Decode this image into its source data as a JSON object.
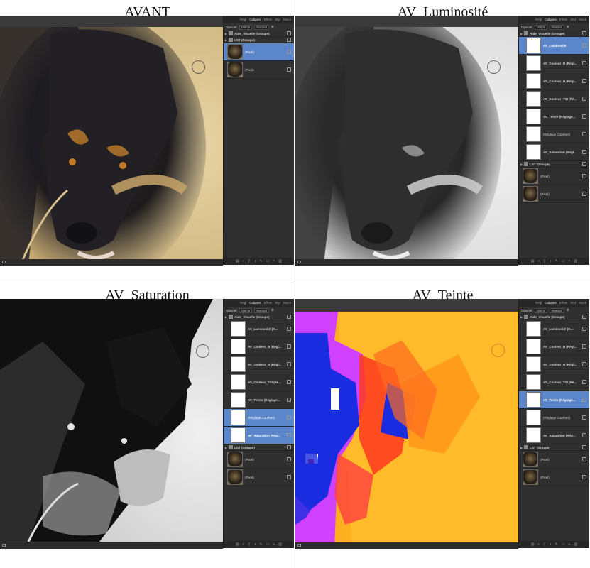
{
  "titles": {
    "q1": "AVANT",
    "q2": "AV_Luminosité",
    "q3": "AV_Saturation",
    "q4": "AV_Teinte"
  },
  "tabs": [
    "Régl",
    "Calques",
    "Effets",
    "Styl",
    "Stock"
  ],
  "active_tab": "Calques",
  "opacity_label": "Opacité",
  "opacity_value": "100 %",
  "blend_mode": "Normal",
  "layers_q1": [
    {
      "type": "grp",
      "name": "Aide_Visuelle (Groupe)"
    },
    {
      "type": "grp",
      "name": "LST (Groupe)"
    },
    {
      "type": "pix",
      "name": "(Pixel)",
      "selected": true
    },
    {
      "type": "pix",
      "name": "(Pixel)",
      "selected": false
    }
  ],
  "layers_q2": [
    {
      "type": "grp",
      "name": "Aide_Visuelle (Groupe)"
    },
    {
      "type": "adj",
      "name": "AV_Luminosité",
      "selected": true
    },
    {
      "type": "adj",
      "name": "AV_Couleur_B (Régl...",
      "selected": false
    },
    {
      "type": "adj",
      "name": "AV_Couleur_N (Régl...",
      "selected": false
    },
    {
      "type": "adj",
      "name": "AV_Couleur_TSI (Ré...",
      "selected": false
    },
    {
      "type": "adj",
      "name": "AV_Teinte (Réglage...",
      "selected": false
    },
    {
      "type": "adj",
      "name": "(Réglage Courbes)",
      "plain": true,
      "selected": false
    },
    {
      "type": "adj",
      "name": "AV_Saturation (Régl...",
      "selected": false
    },
    {
      "type": "grp",
      "name": "LST (Groupe)"
    },
    {
      "type": "pix",
      "name": "(Pixel)",
      "selected": false
    },
    {
      "type": "pix",
      "name": "(Pixel)",
      "selected": false
    }
  ],
  "layers_q3": [
    {
      "type": "grp",
      "name": "Aide_Visuelle (Groupe)"
    },
    {
      "type": "adj",
      "name": "AV_Luminosité (R...",
      "selected": false
    },
    {
      "type": "adj",
      "name": "AV_Couleur_B (Régl...",
      "selected": false
    },
    {
      "type": "adj",
      "name": "AV_Couleur_N (Régl...",
      "selected": false
    },
    {
      "type": "adj",
      "name": "AV_Couleur_TSI (Ré...",
      "selected": false
    },
    {
      "type": "adj",
      "name": "AV_Teinte (Réglage...",
      "selected": false
    },
    {
      "type": "adj",
      "name": "(Réglage Courbes)",
      "plain": true,
      "selected": true
    },
    {
      "type": "adj",
      "name": "AV_Saturation (Rég...",
      "selected": true
    },
    {
      "type": "grp",
      "name": "LST (Groupe)"
    },
    {
      "type": "pix",
      "name": "(Pixel)",
      "selected": false
    },
    {
      "type": "pix",
      "name": "(Pixel)",
      "selected": false
    }
  ],
  "layers_q4": [
    {
      "type": "grp",
      "name": "Aide_Visuelle (Groupe)"
    },
    {
      "type": "adj",
      "name": "AV_Luminosité (R...",
      "selected": false
    },
    {
      "type": "adj",
      "name": "AV_Couleur_B (Régl...",
      "selected": false
    },
    {
      "type": "adj",
      "name": "AV_Couleur_N (Régl...",
      "selected": false
    },
    {
      "type": "adj",
      "name": "AV_Couleur_TSI (Ré...",
      "selected": false
    },
    {
      "type": "adj",
      "name": "AV_Teinte (Réglage...",
      "selected": true
    },
    {
      "type": "adj",
      "name": "(Réglage Courbes)",
      "plain": true,
      "selected": false
    },
    {
      "type": "adj",
      "name": "AV_Saturation (Rég...",
      "selected": false
    },
    {
      "type": "grp",
      "name": "LST (Groupe)"
    },
    {
      "type": "pix",
      "name": "(Pixel)",
      "selected": false
    },
    {
      "type": "pix",
      "name": "(Pixel)",
      "selected": false
    }
  ],
  "bottom_icons": [
    "layers-icon",
    "mask-icon",
    "fx-icon",
    "adjustment-icon",
    "brush-icon",
    "folder-icon",
    "add-icon",
    "trash-icon"
  ],
  "colors": {
    "panel": "#2f2f2f",
    "selection": "#5b86c9",
    "teinte_orange": "#ffb020",
    "teinte_blue": "#1a2ce0",
    "teinte_magenta": "#d040ff"
  }
}
